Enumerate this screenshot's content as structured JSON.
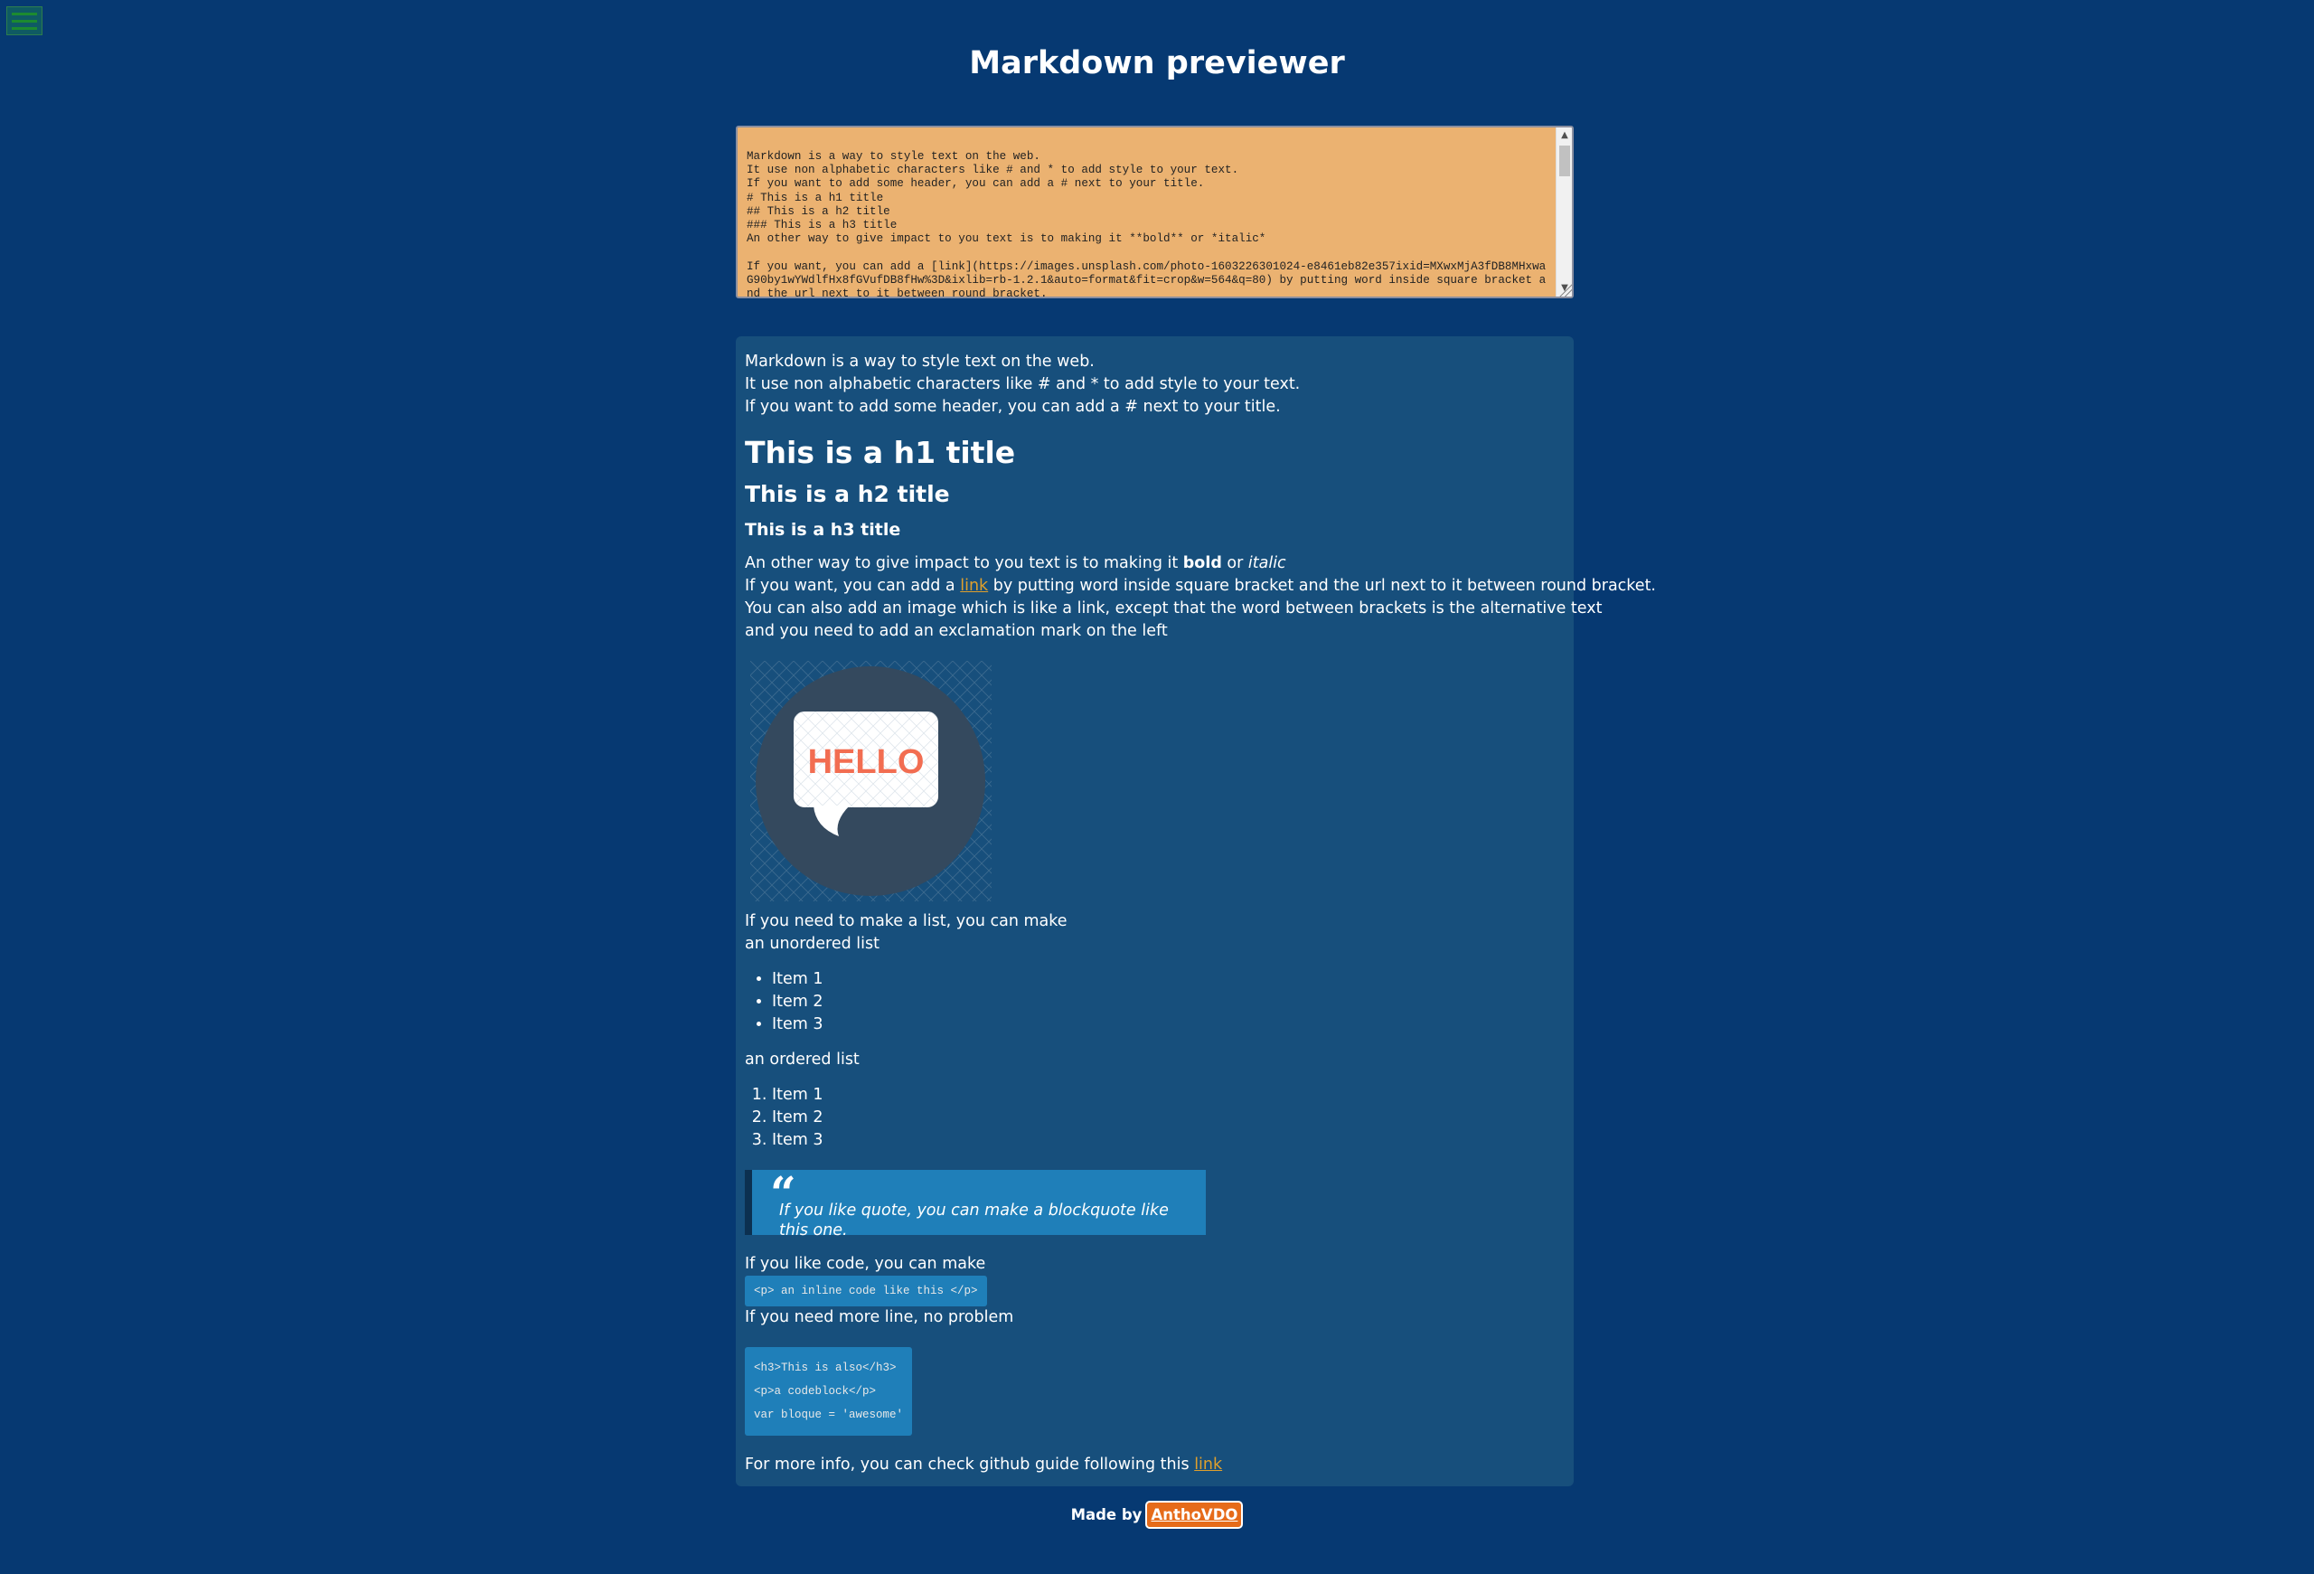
{
  "header": {
    "title": "Markdown previewer"
  },
  "editor": {
    "text": "Markdown is a way to style text on the web.\nIt use non alphabetic characters like # and * to add style to your text.\nIf you want to add some header, you can add a # next to your title.\n# This is a h1 title\n## This is a h2 title\n### This is a h3 title\nAn other way to give impact to you text is to making it **bold** or *italic*\n\nIf you want, you can add a [link](https://images.unsplash.com/photo-1603226301024-e8461eb82e357ixid=MXwxMjA3fDB8MHxwaG90by1wYWdlfHx8fGVufDB8fHw%3D&ixlib=rb-1.2.1&auto=format&fit=crop&w=564&q=80) by putting word inside square bracket and the url next to it between round bracket."
  },
  "preview": {
    "intro_lines": [
      "Markdown is a way to style text on the web.",
      "It use non alphabetic characters like # and * to add style to your text.",
      "If you want to add some header, you can add a # next to your title."
    ],
    "h1": "This is a h1 title",
    "h2": "This is a h2 title",
    "h3": "This is a h3 title",
    "impact_prefix": "An other way to give impact to you text is to making it ",
    "bold_word": "bold",
    "or_word": " or ",
    "italic_word": "italic",
    "link_prefix": "If you want, you can add a ",
    "link_text": "link",
    "link_suffix": " by putting word inside square bracket and the url next to it between round bracket.",
    "image_line_1": "You can also add an image which is like a link, except that the word between brackets is the alternative text",
    "image_line_2": "and you need to add an exclamation mark on the left",
    "image_text": "HELLO",
    "list_intro_1": "If you need to make a list, you can make",
    "list_intro_2": "an unordered list",
    "unordered_items": [
      "Item 1",
      "Item 2",
      "Item 3"
    ],
    "ordered_intro": "an ordered list",
    "ordered_items": [
      "Item 1",
      "Item 2",
      "Item 3"
    ],
    "quote_text": "If you like quote, you can make a blockquote like this one.",
    "code_intro": "If you like code, you can make",
    "inline_code": "<p> an inline code like this </p>",
    "more_lines": "If you need more line, no problem",
    "code_block": "<h3>This is also</h3>\n<p>a codeblock</p>\nvar bloque = 'awesome'",
    "more_info_prefix": "For more info, you can check github guide following this ",
    "more_info_link": "link"
  },
  "footer": {
    "made_by": "Made by",
    "author": "AnthoVDO"
  },
  "colors": {
    "background": "#063972",
    "editor_bg": "#ebb271",
    "preview_bg": "#174f7c",
    "code_bg": "#1f7fb9",
    "link": "#e0a02c",
    "author_button": "#e66b1a",
    "hello_text": "#f26d51",
    "hello_circle": "#34495e"
  },
  "icons": {
    "menu": "hamburger-menu-icon",
    "quote": "quote-icon"
  }
}
